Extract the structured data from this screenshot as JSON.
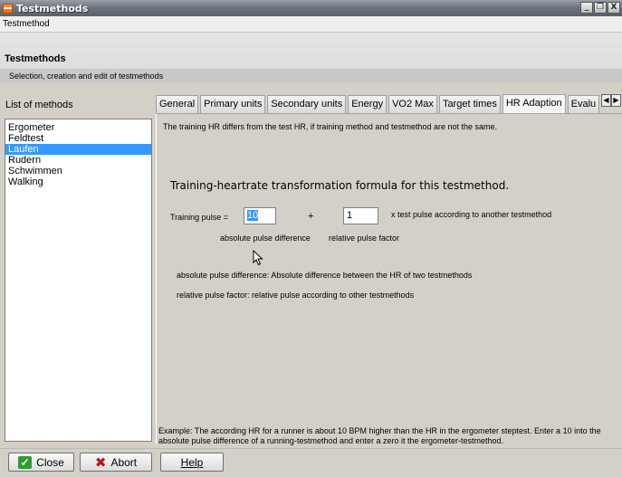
{
  "window": {
    "title": "Testmethods",
    "buttons": [
      "_",
      "❐",
      "X"
    ]
  },
  "menubar": {
    "label": "Testmethod"
  },
  "header": {
    "title": "Testmethods",
    "subtitle": "Selection, creation and edit of testmethods"
  },
  "list": {
    "label": "List of methods",
    "items": [
      "Ergometer",
      "Feldtest",
      "Laufen",
      "Rudern",
      "Schwimmen",
      "Walking"
    ],
    "selected": "Laufen"
  },
  "tabs": [
    "General",
    "Primary units",
    "Secondary units",
    "Energy",
    "VO2 Max",
    "Target times",
    "HR Adaption",
    "Evalu"
  ],
  "active_tab": "HR Adaption",
  "panel": {
    "note": "The training HR differs from the test HR, if training method and testmethod are not the same.",
    "heading": "Training-heartrate transformation formula for this testmethod.",
    "training_pulse_label": "Training pulse =",
    "abs_value": "10",
    "plus": "+",
    "rel_value": "1",
    "suffix": "x test pulse according to another testmethod",
    "abs_label": "absolute pulse difference",
    "rel_label": "relative pulse factor",
    "desc1": "absolute pulse difference: Absolute difference between the HR of two testmethods",
    "desc2": "relative pulse factor: relative pulse according to other testmethods",
    "example": "Example: The according HR for a runner is about 10 BPM higher than the HR in the ergometer steptest. Enter a 10 into the absolute pulse difference of a running-testmethod and enter a zero it the ergometer-testmethod."
  },
  "buttons": {
    "close": "Close",
    "abort": "Abort",
    "help": "Help"
  },
  "icons": {
    "app": "app-icon",
    "close": "check-icon",
    "abort": "x-icon"
  },
  "colors": {
    "selection": "#3399ff",
    "title_bar": "#6f7580",
    "check_green": "#2e9b2e",
    "abort_red": "#c21010"
  }
}
